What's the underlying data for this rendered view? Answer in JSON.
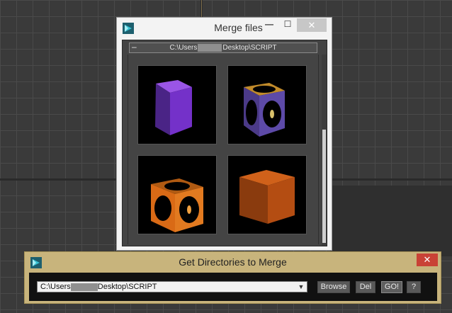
{
  "merge_window": {
    "title": "Merge files",
    "minimize_glyph": "—",
    "maximize_glyph": "☐",
    "close_glyph": "✕",
    "rollout": {
      "collapse_glyph": "–",
      "path_prefix": "C:\\Users",
      "path_suffix": "Desktop\\SCRIPT"
    },
    "thumbnails": [
      {
        "name": "purple-cube",
        "color": "#7a3bc9"
      },
      {
        "name": "patterned-cube-purple",
        "color": "#6a4bb0"
      },
      {
        "name": "patterned-cube-orange",
        "color": "#d86a1a"
      },
      {
        "name": "orange-cube",
        "color": "#b94d10"
      }
    ]
  },
  "directories_window": {
    "title": "Get Directories to Merge",
    "close_glyph": "✕",
    "path_prefix": "C:\\Users",
    "path_suffix": "Desktop\\SCRIPT",
    "buttons": {
      "browse": "Browse",
      "del": "Del",
      "go": "GO!",
      "help": "?"
    }
  },
  "colors": {
    "accent_close": "#c94236",
    "window_gold": "#c8b47c"
  }
}
